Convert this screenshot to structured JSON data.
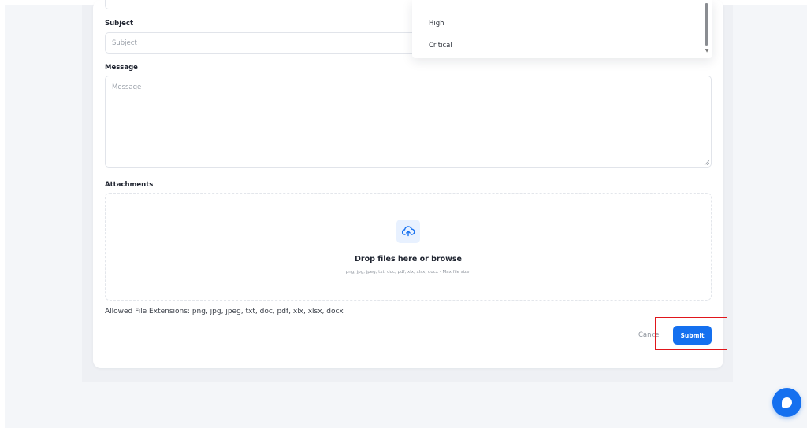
{
  "form": {
    "subject": {
      "label": "Subject",
      "placeholder": "Subject"
    },
    "message": {
      "label": "Message",
      "placeholder": "Message"
    },
    "attachments": {
      "label": "Attachments",
      "drop_title": "Drop files here or browse",
      "drop_hint": "png, jpg, jpeg, txt, doc, pdf, xlx, xlsx, docx - Max file size:",
      "icon": "cloud-upload-icon"
    },
    "allowed_extensions": "Allowed File Extensions: png, jpg, jpeg, txt, doc, pdf, xlx, xlsx, docx",
    "actions": {
      "cancel_label": "Cancel",
      "submit_label": "Submit"
    }
  },
  "priority_dropdown": {
    "options": [
      "High",
      "Critical"
    ]
  },
  "chat_widget": {
    "icon": "chat-bubble-icon"
  },
  "colors": {
    "accent": "#1570ef",
    "highlight_box": "#e0161b",
    "background": "#f4f6f9"
  }
}
